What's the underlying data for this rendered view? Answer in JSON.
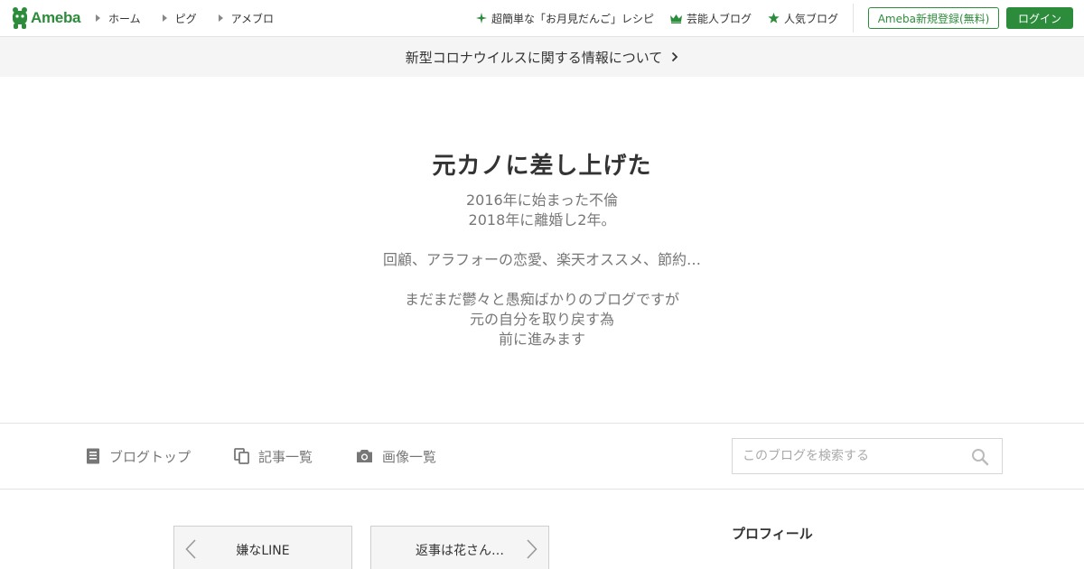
{
  "header": {
    "logo_text": "Ameba",
    "nav_left": [
      {
        "label": "ホーム"
      },
      {
        "label": "ピグ"
      },
      {
        "label": "アメブロ"
      }
    ],
    "nav_right": [
      {
        "label": "超簡単な「お月見だんご」レシピ",
        "icon": "sparkle-icon"
      },
      {
        "label": "芸能人ブログ",
        "icon": "crown-icon"
      },
      {
        "label": "人気ブログ",
        "icon": "star-icon"
      }
    ],
    "register_label": "Ameba新規登録(無料)",
    "login_label": "ログイン"
  },
  "notice": {
    "text": "新型コロナウイルスに関する情報について"
  },
  "hero": {
    "title": "元カノに差し上げた",
    "description_lines": [
      "2016年に始まった不倫",
      "2018年に離婚し2年。",
      "",
      "回顧、アラフォーの恋愛、楽天オススメ、節約…",
      "",
      "まだまだ鬱々と愚痴ばかりのブログですが",
      "元の自分を取り戻す為",
      "前に進みます"
    ]
  },
  "blog_nav": {
    "items": [
      {
        "label": "ブログトップ",
        "icon": "document-icon"
      },
      {
        "label": "記事一覧",
        "icon": "copy-icon"
      },
      {
        "label": "画像一覧",
        "icon": "camera-icon"
      }
    ],
    "search_placeholder": "このブログを検索する"
  },
  "pager": {
    "prev_label": "嫌なLINE",
    "next_label": "返事は花さん…"
  },
  "sidebar": {
    "profile_heading": "プロフィール"
  },
  "colors": {
    "brand": "#2d8c3c",
    "notice_bg": "#f5f5f5",
    "muted_text": "#777777"
  }
}
